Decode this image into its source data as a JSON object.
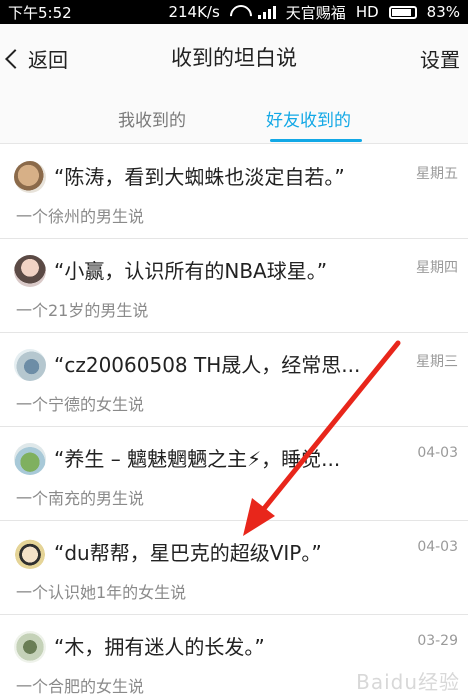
{
  "status_bar": {
    "time": "下午5:52",
    "network_speed": "214K/s",
    "carrier": "天官赐福",
    "hd": "HD",
    "battery": "83%",
    "icons": [
      "wifi-icon",
      "signal-icon",
      "battery-icon"
    ]
  },
  "nav": {
    "back_label": "返回",
    "title": "收到的坦白说",
    "settings_label": "设置"
  },
  "tabs": [
    {
      "label": "我收到的",
      "active": false
    },
    {
      "label": "好友收到的",
      "active": true
    }
  ],
  "colors": {
    "accent": "#12a8e6",
    "arrow_red": "#e8261b"
  },
  "items": [
    {
      "quote": "“陈涛，看到大蜘蛛也淡定自若。”",
      "time": "星期五",
      "desc": "一个徐州的男生说",
      "avatar": "avatar-dog"
    },
    {
      "quote": "“小赢，认识所有的NBA球星。”",
      "time": "星期四",
      "desc": "一个21岁的男生说",
      "avatar": "avatar-girl"
    },
    {
      "quote": "“cz20060508 TH晟人，经常思...",
      "time": "星期三",
      "desc": "一个宁德的女生说",
      "avatar": "avatar-cartoon"
    },
    {
      "quote": "“养生 – 魑魅魍魉之主⚡，睡觉...",
      "time": "04-03",
      "desc": "一个南充的男生说",
      "avatar": "avatar-landscape"
    },
    {
      "quote": "“du帮帮，星巴克的超级VIP。”",
      "time": "04-03",
      "desc": "一个认识她1年的女生说",
      "avatar": "avatar-anime"
    },
    {
      "quote": "“木，拥有迷人的长发。”",
      "time": "03-29",
      "desc": "一个合肥的女生说",
      "avatar": "avatar-art"
    }
  ],
  "watermark": "Baidu经验"
}
